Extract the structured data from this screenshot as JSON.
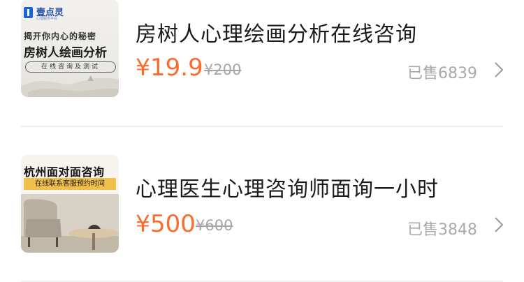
{
  "currency_symbol": "¥",
  "items": [
    {
      "title": "房树人心理绘画分析在线咨询",
      "price": "19.9",
      "original_price": "¥200",
      "sold": "已售6839",
      "thumbnail": {
        "logo_text": "壹点灵",
        "logo_sub": "心理服务平台",
        "line1": "揭开你内心的秘密",
        "line2": "房树人绘画分析",
        "line3": "在线咨询及测试"
      }
    },
    {
      "title": "心理医生心理咨询师面询一小时",
      "price": "500",
      "original_price": "¥600",
      "sold": "已售3848",
      "thumbnail": {
        "line1": "杭州面对面咨询",
        "line2": "在线联系客服预约时间"
      }
    }
  ],
  "colors": {
    "price": "#fb6b2c",
    "muted": "#a9a9a9",
    "divider": "#efefef",
    "logo_blue": "#1e63d6",
    "banner_yellow": "#f2c04a"
  },
  "icons": {
    "chevron": "chevron-right-icon"
  }
}
